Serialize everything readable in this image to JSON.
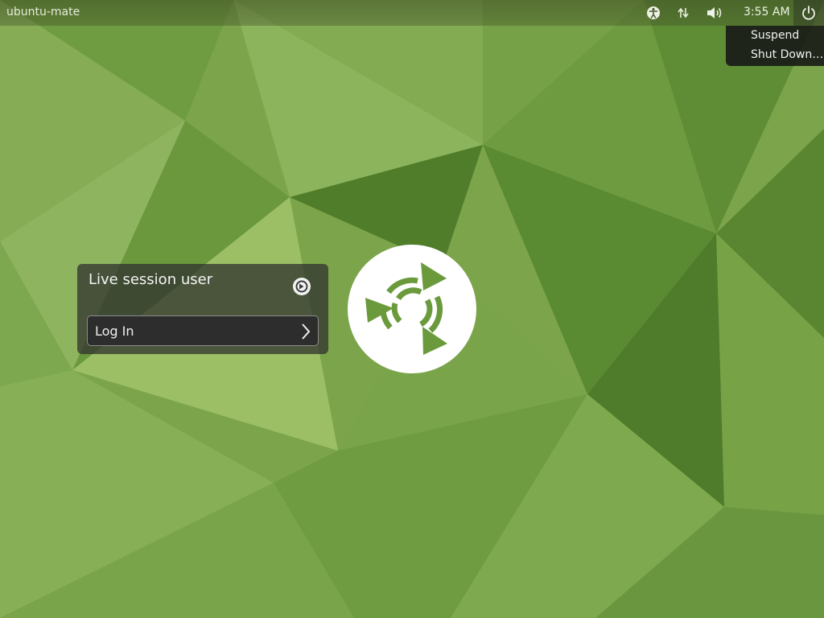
{
  "panel": {
    "hostname": "ubuntu-mate",
    "clock": "3:55 AM",
    "indicators": [
      "accessibility-icon",
      "network-icon",
      "volume-icon",
      "power-icon"
    ]
  },
  "power_menu": {
    "items": [
      "Suspend",
      "Shut Down…"
    ]
  },
  "login": {
    "user_name": "Live session user",
    "button_label": "Log In"
  },
  "colors": {
    "wallpaper_base": "#7aa24a",
    "wallpaper_dark": "#5f8a33",
    "wallpaper_light": "#98bc62",
    "panel_text": "#e8ecdc",
    "box_bg": "#2d2d2d",
    "logo": "#ffffff"
  }
}
